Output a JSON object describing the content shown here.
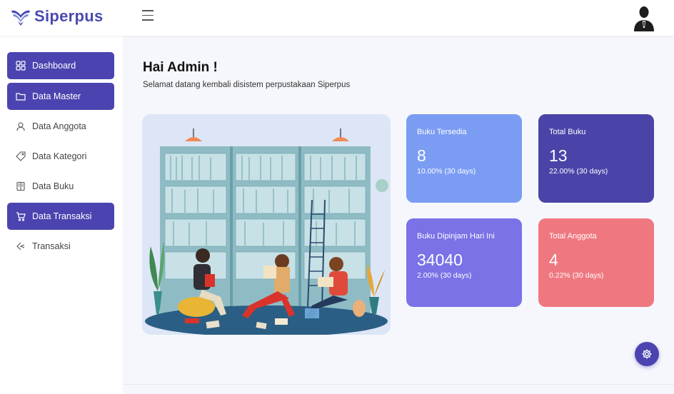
{
  "header": {
    "brand": "Siperpus",
    "brand_color": "#4a4ab0"
  },
  "sidebar": {
    "active_color": "#4b44b0",
    "items": [
      {
        "label": "Dashboard",
        "icon": "grid-icon",
        "active": true
      },
      {
        "label": "Data Master",
        "icon": "folder-icon",
        "active": true
      },
      {
        "label": "Data Anggota",
        "icon": "user-icon",
        "active": false
      },
      {
        "label": "Data Kategori",
        "icon": "tag-icon",
        "active": false
      },
      {
        "label": "Data Buku",
        "icon": "book-icon",
        "active": false
      },
      {
        "label": "Data Transaksi",
        "icon": "cart-icon",
        "active": true
      },
      {
        "label": "Transaksi",
        "icon": "arrow-left-icon",
        "active": false
      }
    ]
  },
  "main": {
    "greeting": "Hai Admin !",
    "subtitle": "Selamat datang kembali disistem perpustakaan Siperpus"
  },
  "stats": [
    {
      "title": "Buku Tersedia",
      "value": "8",
      "change": "10.00% (30 days)",
      "color": "#7b9cf3"
    },
    {
      "title": "Total Buku",
      "value": "13",
      "change": "22.00% (30 days)",
      "color": "#4a44a8"
    },
    {
      "title": "Buku Dipinjam Hari Ini",
      "value": "34040",
      "change": "2.00% (30 days)",
      "color": "#7a72e6"
    },
    {
      "title": "Total Anggota",
      "value": "4",
      "change": "0.22% (30 days)",
      "color": "#ef7880"
    }
  ],
  "fab_icon": "gear-icon"
}
